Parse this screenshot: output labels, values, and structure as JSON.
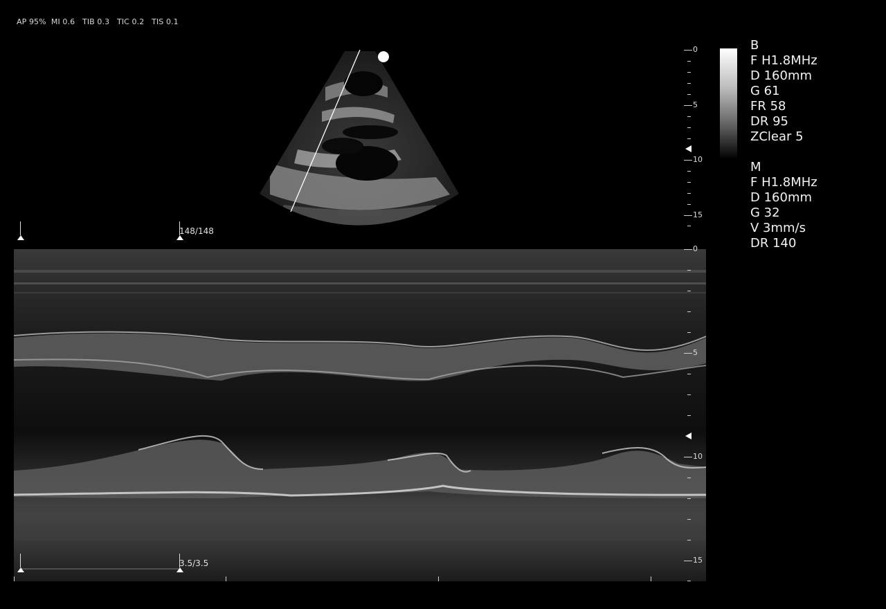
{
  "top_info": "AP 95%  MI 0.6   TIB 0.3   TIC 0.2   TIS 0.1",
  "orientation_marker_icon": "orientation-dot-icon",
  "bmode_depth_scale": {
    "labels": [
      "0",
      "5",
      "10",
      "15"
    ]
  },
  "mmode_depth_scale": {
    "labels": [
      "0",
      "5",
      "10",
      "15"
    ]
  },
  "b_params": {
    "mode": "B",
    "freq": "F H1.8MHz",
    "depth": "D 160mm",
    "gain": "G 61",
    "frame_rate": "FR 58",
    "dynamic_range": "DR 95",
    "zclear": "ZClear 5"
  },
  "m_params": {
    "mode": "M",
    "freq": "F H1.8MHz",
    "depth": "D 160mm",
    "gain": "G 32",
    "sweep": "V 3mm/s",
    "dynamic_range": "DR 140"
  },
  "cine": {
    "frame_counter": "148/148",
    "time_counter": "3.5/3.5"
  }
}
